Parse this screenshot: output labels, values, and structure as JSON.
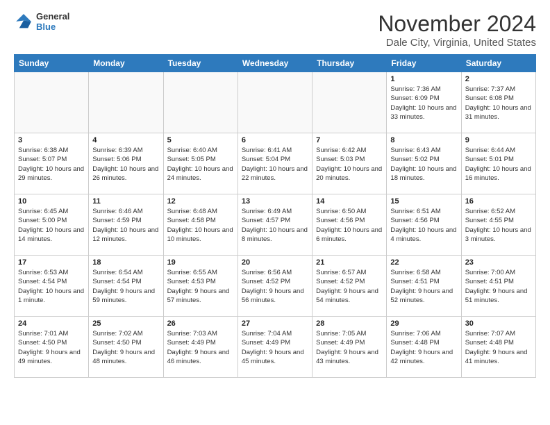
{
  "header": {
    "logo_line1": "General",
    "logo_line2": "Blue",
    "title": "November 2024",
    "subtitle": "Dale City, Virginia, United States"
  },
  "weekdays": [
    "Sunday",
    "Monday",
    "Tuesday",
    "Wednesday",
    "Thursday",
    "Friday",
    "Saturday"
  ],
  "weeks": [
    [
      {
        "day": "",
        "info": ""
      },
      {
        "day": "",
        "info": ""
      },
      {
        "day": "",
        "info": ""
      },
      {
        "day": "",
        "info": ""
      },
      {
        "day": "",
        "info": ""
      },
      {
        "day": "1",
        "info": "Sunrise: 7:36 AM\nSunset: 6:09 PM\nDaylight: 10 hours and 33 minutes."
      },
      {
        "day": "2",
        "info": "Sunrise: 7:37 AM\nSunset: 6:08 PM\nDaylight: 10 hours and 31 minutes."
      }
    ],
    [
      {
        "day": "3",
        "info": "Sunrise: 6:38 AM\nSunset: 5:07 PM\nDaylight: 10 hours and 29 minutes."
      },
      {
        "day": "4",
        "info": "Sunrise: 6:39 AM\nSunset: 5:06 PM\nDaylight: 10 hours and 26 minutes."
      },
      {
        "day": "5",
        "info": "Sunrise: 6:40 AM\nSunset: 5:05 PM\nDaylight: 10 hours and 24 minutes."
      },
      {
        "day": "6",
        "info": "Sunrise: 6:41 AM\nSunset: 5:04 PM\nDaylight: 10 hours and 22 minutes."
      },
      {
        "day": "7",
        "info": "Sunrise: 6:42 AM\nSunset: 5:03 PM\nDaylight: 10 hours and 20 minutes."
      },
      {
        "day": "8",
        "info": "Sunrise: 6:43 AM\nSunset: 5:02 PM\nDaylight: 10 hours and 18 minutes."
      },
      {
        "day": "9",
        "info": "Sunrise: 6:44 AM\nSunset: 5:01 PM\nDaylight: 10 hours and 16 minutes."
      }
    ],
    [
      {
        "day": "10",
        "info": "Sunrise: 6:45 AM\nSunset: 5:00 PM\nDaylight: 10 hours and 14 minutes."
      },
      {
        "day": "11",
        "info": "Sunrise: 6:46 AM\nSunset: 4:59 PM\nDaylight: 10 hours and 12 minutes."
      },
      {
        "day": "12",
        "info": "Sunrise: 6:48 AM\nSunset: 4:58 PM\nDaylight: 10 hours and 10 minutes."
      },
      {
        "day": "13",
        "info": "Sunrise: 6:49 AM\nSunset: 4:57 PM\nDaylight: 10 hours and 8 minutes."
      },
      {
        "day": "14",
        "info": "Sunrise: 6:50 AM\nSunset: 4:56 PM\nDaylight: 10 hours and 6 minutes."
      },
      {
        "day": "15",
        "info": "Sunrise: 6:51 AM\nSunset: 4:56 PM\nDaylight: 10 hours and 4 minutes."
      },
      {
        "day": "16",
        "info": "Sunrise: 6:52 AM\nSunset: 4:55 PM\nDaylight: 10 hours and 3 minutes."
      }
    ],
    [
      {
        "day": "17",
        "info": "Sunrise: 6:53 AM\nSunset: 4:54 PM\nDaylight: 10 hours and 1 minute."
      },
      {
        "day": "18",
        "info": "Sunrise: 6:54 AM\nSunset: 4:54 PM\nDaylight: 9 hours and 59 minutes."
      },
      {
        "day": "19",
        "info": "Sunrise: 6:55 AM\nSunset: 4:53 PM\nDaylight: 9 hours and 57 minutes."
      },
      {
        "day": "20",
        "info": "Sunrise: 6:56 AM\nSunset: 4:52 PM\nDaylight: 9 hours and 56 minutes."
      },
      {
        "day": "21",
        "info": "Sunrise: 6:57 AM\nSunset: 4:52 PM\nDaylight: 9 hours and 54 minutes."
      },
      {
        "day": "22",
        "info": "Sunrise: 6:58 AM\nSunset: 4:51 PM\nDaylight: 9 hours and 52 minutes."
      },
      {
        "day": "23",
        "info": "Sunrise: 7:00 AM\nSunset: 4:51 PM\nDaylight: 9 hours and 51 minutes."
      }
    ],
    [
      {
        "day": "24",
        "info": "Sunrise: 7:01 AM\nSunset: 4:50 PM\nDaylight: 9 hours and 49 minutes."
      },
      {
        "day": "25",
        "info": "Sunrise: 7:02 AM\nSunset: 4:50 PM\nDaylight: 9 hours and 48 minutes."
      },
      {
        "day": "26",
        "info": "Sunrise: 7:03 AM\nSunset: 4:49 PM\nDaylight: 9 hours and 46 minutes."
      },
      {
        "day": "27",
        "info": "Sunrise: 7:04 AM\nSunset: 4:49 PM\nDaylight: 9 hours and 45 minutes."
      },
      {
        "day": "28",
        "info": "Sunrise: 7:05 AM\nSunset: 4:49 PM\nDaylight: 9 hours and 43 minutes."
      },
      {
        "day": "29",
        "info": "Sunrise: 7:06 AM\nSunset: 4:48 PM\nDaylight: 9 hours and 42 minutes."
      },
      {
        "day": "30",
        "info": "Sunrise: 7:07 AM\nSunset: 4:48 PM\nDaylight: 9 hours and 41 minutes."
      }
    ]
  ]
}
